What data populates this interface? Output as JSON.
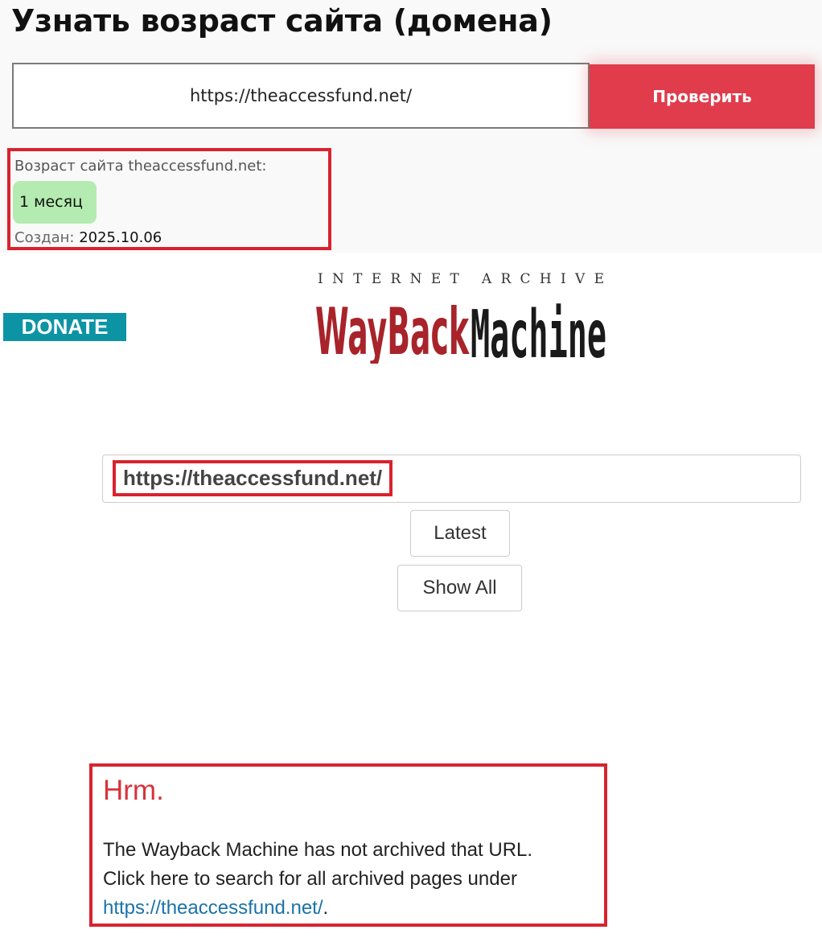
{
  "checker": {
    "title": "Узнать возраст сайта (домена)",
    "input_value": "https://theaccessfund.net/",
    "check_button": "Проверить",
    "result": {
      "age_label": "Возраст сайта theaccessfund.net:",
      "age_value": "1 месяц",
      "created_label": "Создан:",
      "created_value": "2025.10.06",
      "badge_color": "#b4ebb0"
    },
    "accent_color": "#e03c4b"
  },
  "wayback": {
    "donate_label": "DONATE",
    "logo": {
      "top_text": "INTERNET ARCHIVE",
      "word_wayback": "WayBack",
      "word_machine": "Machine"
    },
    "url": "https://theaccessfund.net/",
    "latest_button": "Latest",
    "show_all_button": "Show All",
    "error": {
      "title": "Hrm.",
      "line1": "The Wayback Machine has not archived that URL.",
      "line2": "Click here to search for all archived pages under",
      "link": "https://theaccessfund.net/",
      "suffix": "."
    },
    "donate_color": "#0c94a4"
  }
}
